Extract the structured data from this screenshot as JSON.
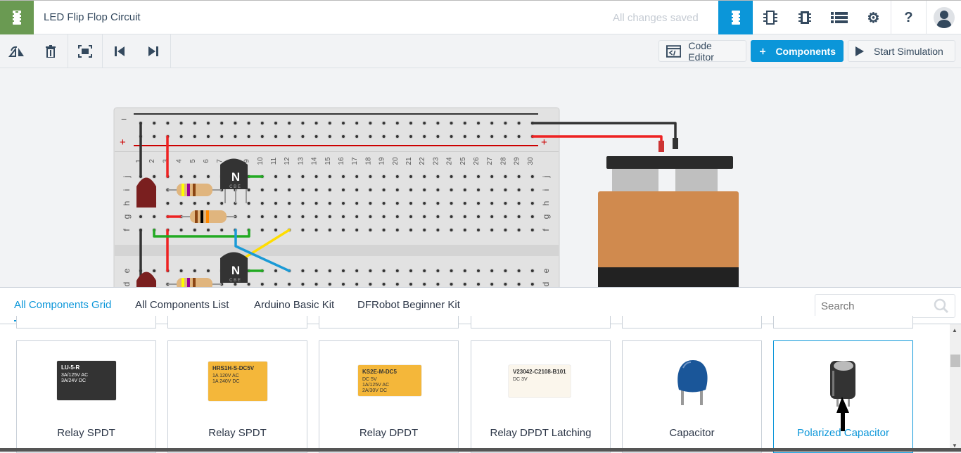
{
  "header": {
    "title": "LED Flip Flop Circuit",
    "status": "All changes saved",
    "icons": [
      "circuit-view-icon",
      "component-view-icon",
      "schematic-view-icon",
      "list-icon",
      "gear-icon",
      "help-icon",
      "user-avatar-icon"
    ],
    "help_glyph": "?"
  },
  "toolbar": {
    "tools": [
      "rotate-icon",
      "delete-icon",
      "fit-view-icon",
      "previous-icon",
      "next-icon"
    ],
    "code_editor": "Code Editor",
    "components": "Components",
    "start_simulation": "Start Simulation"
  },
  "breadboard": {
    "rail_minus": "−",
    "rail_plus": "+",
    "rows_top": [
      "j",
      "i",
      "h",
      "g",
      "f"
    ],
    "rows_bottom": [
      "e",
      "d"
    ],
    "columns": [
      "1",
      "2",
      "3",
      "4",
      "5",
      "6",
      "7",
      "8",
      "9",
      "10",
      "11",
      "12",
      "13",
      "14",
      "15",
      "16",
      "17",
      "18",
      "19",
      "20",
      "21",
      "22",
      "23",
      "24",
      "25",
      "26",
      "27",
      "28",
      "29",
      "30"
    ],
    "transistor_label": "N",
    "transistor_pins": "C  B  E"
  },
  "panel": {
    "tabs": [
      {
        "label": "All Components Grid",
        "active": true
      },
      {
        "label": "All Components List"
      },
      {
        "label": "Arduino Basic Kit"
      },
      {
        "label": "DFRobot Beginner Kit"
      }
    ],
    "search_placeholder": "Search",
    "cards": [
      {
        "label": "Relay SPDT",
        "part": "LU-5-R",
        "spec1": "3A/125V AC",
        "spec2": "3A/24V  DC",
        "color": "#333333"
      },
      {
        "label": "Relay SPDT",
        "part": "HRS1H-S-DC5V",
        "spec1": "1A  120V AC",
        "spec2": "1A  240V DC",
        "color": "#f4b73a"
      },
      {
        "label": "Relay DPDT",
        "part": "KS2E-M-DC5",
        "spec0": "DC 5V",
        "spec1": "1A/125V AC",
        "spec2": "2A/30V DC",
        "color": "#f4b73a"
      },
      {
        "label": "Relay DPDT Latching",
        "part": "V23042-C2108-B101",
        "spec1": "DC 3V",
        "color": "#fbf6ec"
      },
      {
        "label": "Capacitor",
        "color": "#1a5699"
      },
      {
        "label": "Polarized Capacitor",
        "selected": true,
        "color": "#333333"
      }
    ]
  },
  "colors": {
    "accent": "#0b96d9",
    "logo": "#6a9a52"
  }
}
